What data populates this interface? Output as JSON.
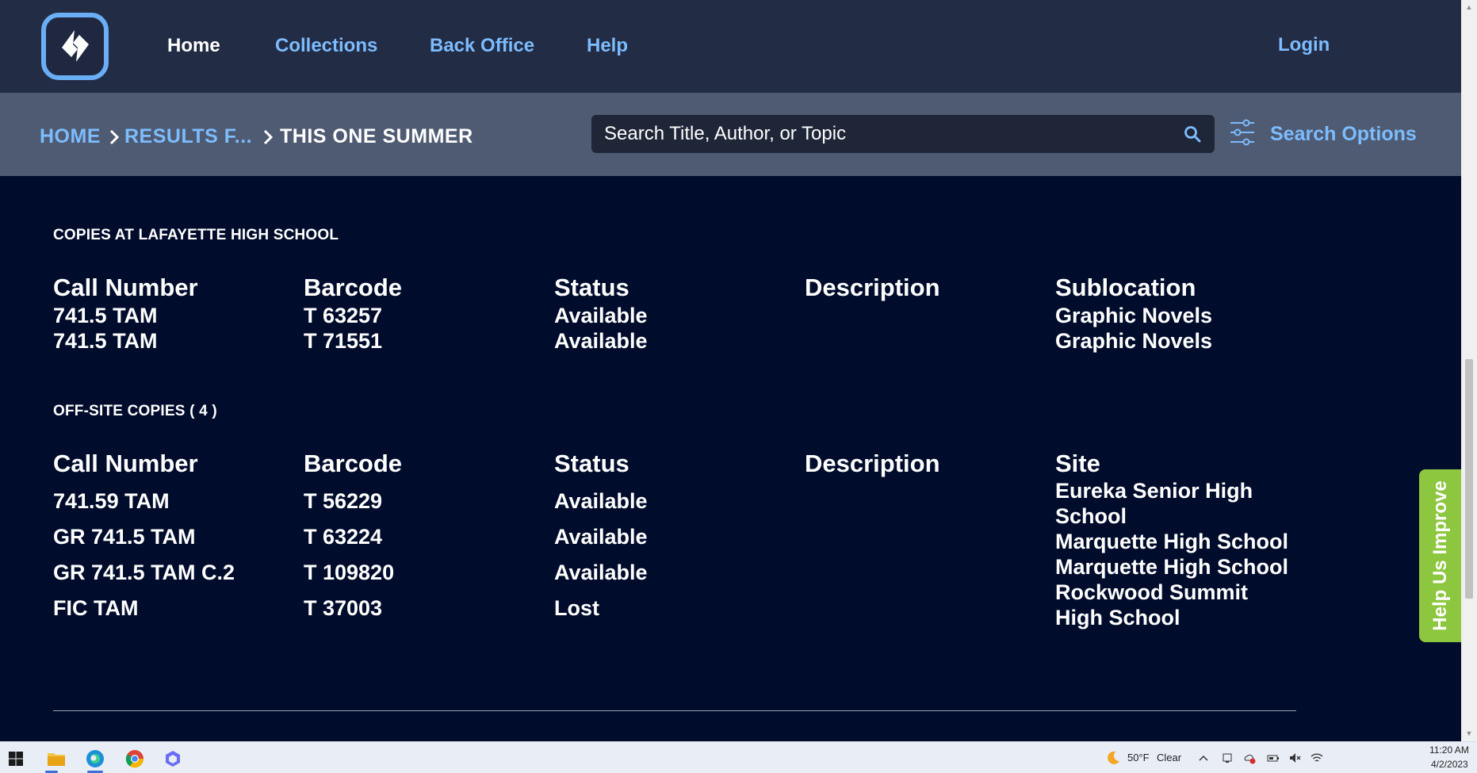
{
  "nav": {
    "links": [
      "Home",
      "Collections",
      "Back Office",
      "Help"
    ],
    "login": "Login"
  },
  "breadcrumb": {
    "home": "HOME",
    "results": "RESULTS F...",
    "current": "THIS ONE SUMMER"
  },
  "search": {
    "placeholder": "Search Title, Author, or Topic",
    "options_label": "Search Options"
  },
  "local_copies": {
    "title": "COPIES AT LAFAYETTE HIGH SCHOOL",
    "columns": [
      "Call Number",
      "Barcode",
      "Status",
      "Description",
      "Sublocation"
    ],
    "rows": [
      {
        "call_number": "741.5 TAM",
        "barcode": "T 63257",
        "status": "Available",
        "description": "",
        "sublocation": "Graphic Novels"
      },
      {
        "call_number": "741.5 TAM",
        "barcode": "T 71551",
        "status": "Available",
        "description": "",
        "sublocation": "Graphic Novels"
      }
    ]
  },
  "offsite_copies": {
    "title": "OFF-SITE COPIES ( 4 )",
    "columns": [
      "Call Number",
      "Barcode",
      "Status",
      "Description",
      "Site"
    ],
    "rows": [
      {
        "call_number": "741.59 TAM",
        "barcode": "T 56229",
        "status": "Available",
        "description": ""
      },
      {
        "call_number": "GR 741.5 TAM",
        "barcode": "T 63224",
        "status": "Available",
        "description": ""
      },
      {
        "call_number": "GR 741.5 TAM C.2",
        "barcode": "T 109820",
        "status": "Available",
        "description": ""
      },
      {
        "call_number": "FIC TAM",
        "barcode": "T 37003",
        "status": "Lost",
        "description": ""
      }
    ],
    "site_lines": [
      "Eureka Senior High",
      "School",
      "Marquette High School",
      "Marquette High School",
      "Rockwood Summit",
      "High School"
    ]
  },
  "help_tab": "Help Us Improve",
  "taskbar": {
    "weather": "50°F",
    "weather_condition": "Clear",
    "time": "11:20 AM",
    "date": "4/2/2023"
  },
  "colors": {
    "top_nav": "#222c44",
    "subbar": "#4f5b72",
    "content_bg": "#000c2b",
    "link": "#7cbcff",
    "help_tab": "#8dc63f"
  }
}
